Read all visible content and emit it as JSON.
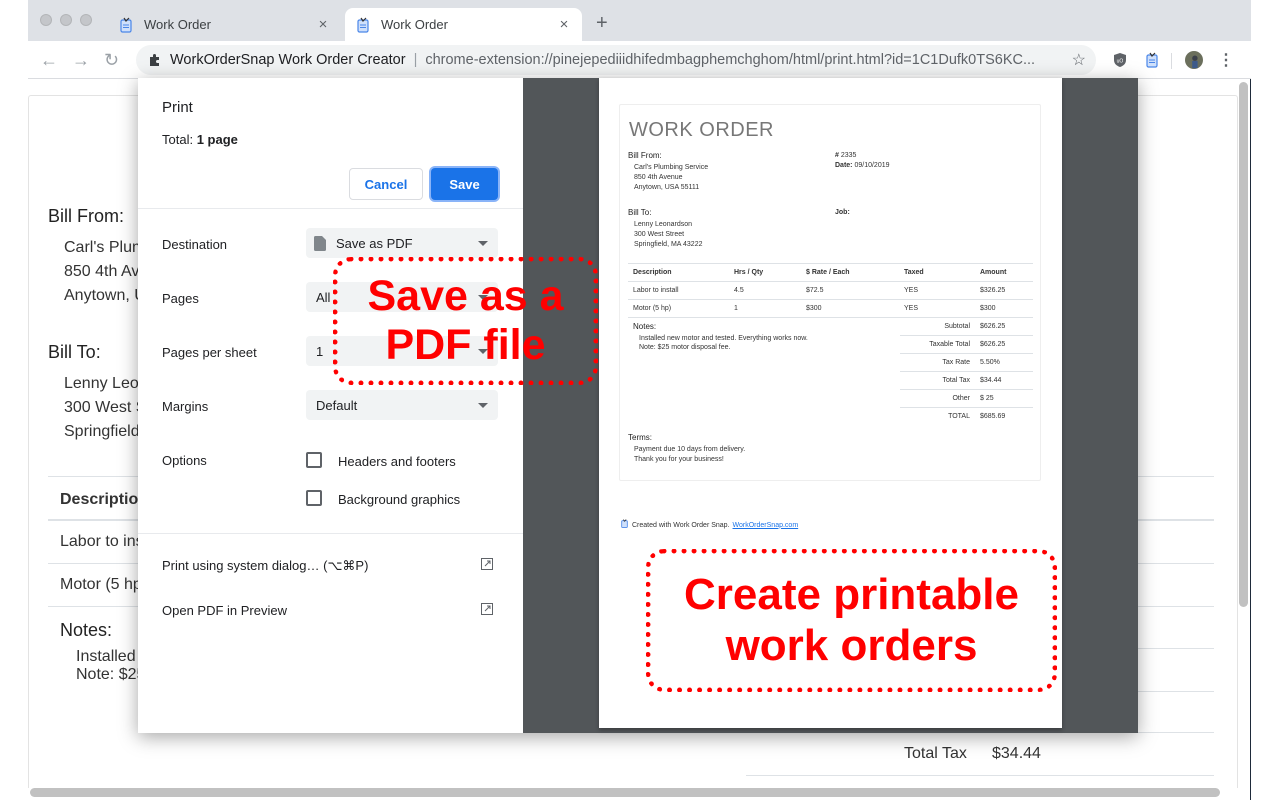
{
  "browser": {
    "tabs": [
      {
        "title": "Work Order",
        "active": false
      },
      {
        "title": "Work Order",
        "active": true
      }
    ],
    "new_tab_icon": "plus-icon",
    "omnibox": {
      "site_name": "WorkOrderSnap Work Order Creator",
      "url": "chrome-extension://pinejepediiidhifedmbagphemchghom/html/print.html?id=1C1Dufk0TS6KC..."
    },
    "nav_icons": [
      "back-arrow-icon",
      "forward-arrow-icon",
      "reload-icon"
    ]
  },
  "background_page": {
    "bill_from_label": "Bill From:",
    "bill_from_lines": [
      "Carl's Plumbing Service",
      "850 4th Avenue",
      "Anytown, USA 55111"
    ],
    "bill_to_label": "Bill To:",
    "bill_to_lines": [
      "Lenny Leonardson",
      "300 West Street",
      "Springfield, MA 43222"
    ],
    "description_header": "Description",
    "rows": [
      "Labor to install",
      "Motor (5 hp)"
    ],
    "notes_label": "Notes:",
    "notes_lines": [
      "Installed new motor and tested. Everything works now.",
      "Note: $25 motor disposal fee."
    ],
    "total_tax_label": "Total Tax",
    "total_tax_value": "$34.44"
  },
  "print_dialog": {
    "title": "Print",
    "total_label": "Total:",
    "total_value": "1 page",
    "cancel_label": "Cancel",
    "save_label": "Save",
    "destination_label": "Destination",
    "destination_value": "Save as PDF",
    "pages_label": "Pages",
    "pages_value": "All",
    "pages_per_sheet_label": "Pages per sheet",
    "pages_per_sheet_value": "1",
    "margins_label": "Margins",
    "margins_value": "Default",
    "options_label": "Options",
    "option_headers_footers": "Headers and footers",
    "option_headers_footers_checked": false,
    "option_background_graphics": "Background graphics",
    "option_background_graphics_checked": false,
    "system_dialog_label": "Print using system dialog… (⌥⌘P)",
    "open_preview_label": "Open PDF in Preview"
  },
  "preview_doc": {
    "title": "WORK ORDER",
    "bill_from_label": "Bill From:",
    "bill_from_lines": [
      "Carl's Plumbing Service",
      "850 4th Avenue",
      "Anytown, USA 55111"
    ],
    "number_label": "#",
    "number_value": "2335",
    "date_label": "Date:",
    "date_value": "09/10/2019",
    "bill_to_label": "Bill To:",
    "bill_to_lines": [
      "Lenny Leonardson",
      "300 West Street",
      "Springfield, MA 43222"
    ],
    "job_label": "Job:",
    "table_headers": [
      "Description",
      "Hrs / Qty",
      "$ Rate / Each",
      "Taxed",
      "Amount"
    ],
    "table_rows": [
      [
        "Labor to install",
        "4.5",
        "$72.5",
        "YES",
        "$326.25"
      ],
      [
        "Motor (5 hp)",
        "1",
        "$300",
        "YES",
        "$300"
      ]
    ],
    "notes_label": "Notes:",
    "notes_lines": [
      "Installed new motor and tested. Everything works now.",
      "Note: $25 motor disposal fee."
    ],
    "totals": [
      {
        "label": "Subtotal",
        "value": "$626.25"
      },
      {
        "label": "Taxable Total",
        "value": "$626.25"
      },
      {
        "label": "Tax Rate",
        "value": "5.50%"
      },
      {
        "label": "Total Tax",
        "value": "$34.44"
      },
      {
        "label": "Other",
        "value": "$ 25"
      },
      {
        "label": "TOTAL",
        "value": "$685.69"
      }
    ],
    "terms_label": "Terms:",
    "terms_lines": [
      "Payment due 10 days from delivery.",
      "Thank you for your business!"
    ],
    "footer_text": "Created with Work Order Snap.",
    "footer_link": "WorkOrderSnap.com"
  },
  "annotations": {
    "save_pdf": "Save as a PDF file",
    "create_printable": "Create printable work orders",
    "color": "#ff0000"
  }
}
